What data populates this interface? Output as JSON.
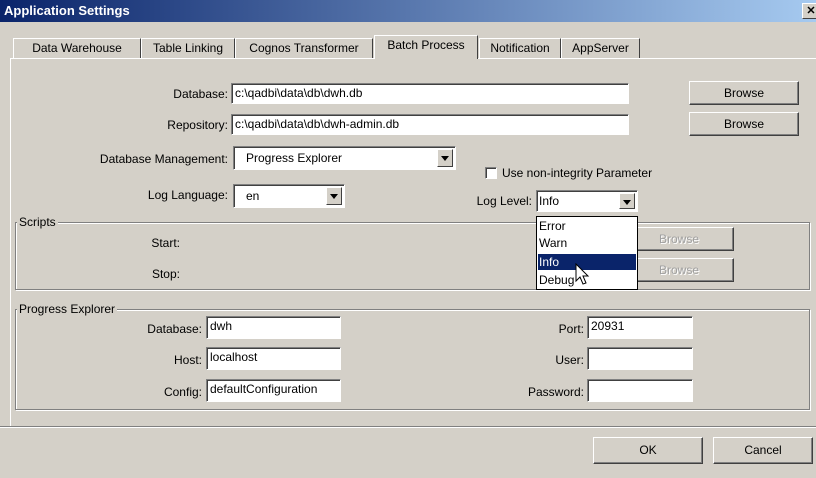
{
  "window": {
    "title": "Application Settings",
    "close_glyph": "✕"
  },
  "tabs": [
    {
      "label": "Data Warehouse"
    },
    {
      "label": "Table Linking"
    },
    {
      "label": "Cognos Transformer"
    },
    {
      "label": "Batch Process",
      "active": true
    },
    {
      "label": "Notification"
    },
    {
      "label": "AppServer"
    }
  ],
  "batch": {
    "database_label": "Database:",
    "database_value": "c:\\qadbi\\data\\db\\dwh.db",
    "repository_label": "Repository:",
    "repository_value": "c:\\qadbi\\data\\db\\dwh-admin.db",
    "browse_label": "Browse",
    "db_mgmt_label": "Database Management:",
    "db_mgmt_value": "Progress Explorer",
    "non_integrity_label": "Use non-integrity Parameter",
    "non_integrity_checked": false,
    "log_language_label": "Log Language:",
    "log_language_value": "en",
    "log_level_label": "Log Level:",
    "log_level_value": "Info",
    "log_level_options": [
      "Error",
      "Warn",
      "Info",
      "Debug"
    ],
    "log_level_highlighted": "Info"
  },
  "scripts": {
    "group_label": "Scripts",
    "start_label": "Start:",
    "stop_label": "Stop:",
    "browse_label": "Browse"
  },
  "progress": {
    "group_label": "Progress Explorer",
    "database_label": "Database:",
    "database_value": "dwh",
    "host_label": "Host:",
    "host_value": "localhost",
    "config_label": "Config:",
    "config_value": "defaultConfiguration",
    "port_label": "Port:",
    "port_value": "20931",
    "user_label": "User:",
    "user_value": "",
    "password_label": "Password:",
    "password_value": ""
  },
  "footer": {
    "ok_label": "OK",
    "cancel_label": "Cancel"
  },
  "colors": {
    "titlebar": "#0a246a",
    "face": "#d4d0c8",
    "selection": "#0a246a"
  }
}
